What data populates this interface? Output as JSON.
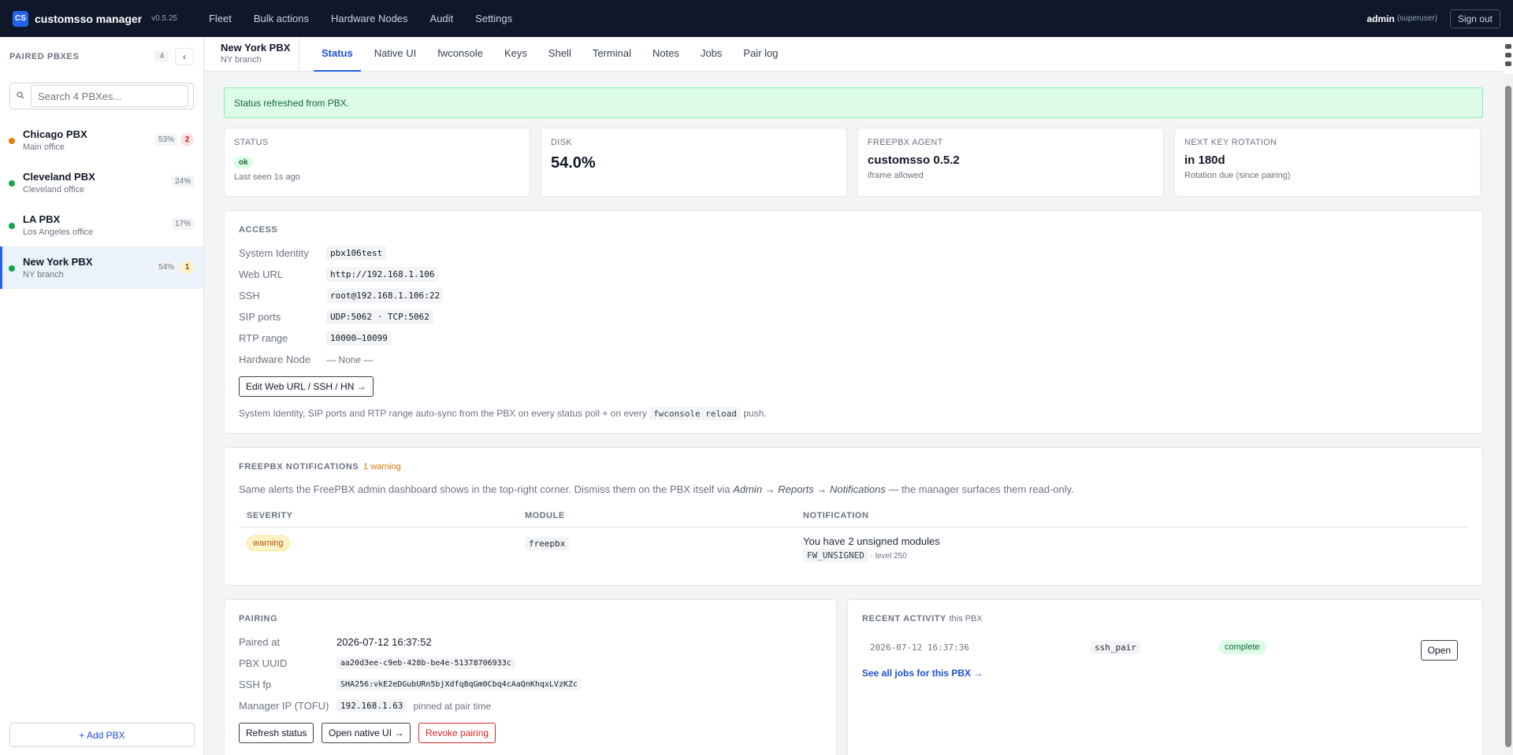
{
  "app": {
    "logo": "CS",
    "name": "customsso manager",
    "version": "v0.5.25"
  },
  "nav": [
    "Fleet",
    "Bulk actions",
    "Hardware Nodes",
    "Audit",
    "Settings"
  ],
  "user": {
    "name": "admin",
    "role": "(superuser)",
    "signout": "Sign out"
  },
  "sidebar": {
    "title": "PAIRED PBXES",
    "count": "4",
    "collapse_glyph": "‹",
    "search_placeholder": "Search 4 PBXes...",
    "items": [
      {
        "name": "Chicago PBX",
        "sub": "Main office",
        "pct": "53%",
        "alerts": "2",
        "alert_color": "red",
        "dot": "#ea7a0c"
      },
      {
        "name": "Cleveland PBX",
        "sub": "Cleveland office",
        "pct": "24%",
        "alerts": "",
        "dot": "#16a34a"
      },
      {
        "name": "LA PBX",
        "sub": "Los Angeles office",
        "pct": "17%",
        "alerts": "",
        "dot": "#16a34a"
      },
      {
        "name": "New York PBX",
        "sub": "NY branch",
        "pct": "54%",
        "alerts": "1",
        "alert_color": "yellow",
        "dot": "#16a34a"
      }
    ],
    "add_label": "+ Add PBX"
  },
  "header": {
    "pbx_name": "New York PBX",
    "pbx_sub": "NY branch",
    "tabs": [
      "Status",
      "Native UI",
      "fwconsole",
      "Keys",
      "Shell",
      "Terminal",
      "Notes",
      "Jobs",
      "Pair log"
    ],
    "active_tab": "Status"
  },
  "alert": "Status refreshed from PBX.",
  "cards": {
    "status": {
      "label": "STATUS",
      "badge": "ok",
      "sub": "Last seen 1s ago"
    },
    "disk": {
      "label": "DISK",
      "value": "54.0%"
    },
    "agent": {
      "label": "FREEPBX AGENT",
      "value": "customsso 0.5.2",
      "sub": "iframe allowed"
    },
    "rotation": {
      "label": "NEXT KEY ROTATION",
      "value": "in 180d",
      "sub": "Rotation due (since pairing)"
    }
  },
  "access": {
    "title": "ACCESS",
    "rows": [
      {
        "k": "System Identity",
        "v": "pbx106test"
      },
      {
        "k": "Web URL",
        "v": "http://192.168.1.106"
      },
      {
        "k": "SSH",
        "v": "root@192.168.1.106:22"
      },
      {
        "k": "SIP ports",
        "v": "UDP:5062 · TCP:5062"
      },
      {
        "k": "RTP range",
        "v": "10000–10099"
      }
    ],
    "hardware_node": {
      "k": "Hardware Node",
      "v": "— None —"
    },
    "edit_button": "Edit Web URL / SSH / HN →",
    "note_pre": "System Identity, SIP ports and RTP range auto-sync from the PBX on every status poll + on every",
    "note_code": "fwconsole reload",
    "note_post": "push."
  },
  "notifications": {
    "title": "FREEPBX NOTIFICATIONS",
    "count": "1 warning",
    "desc_pre": "Same alerts the FreePBX admin dashboard shows in the top-right corner. Dismiss them on the PBX itself via",
    "desc_path": "Admin → Reports → Notifications",
    "desc_post": "— the manager surfaces them read-only.",
    "columns": [
      "SEVERITY",
      "MODULE",
      "NOTIFICATION"
    ],
    "rows": [
      {
        "severity": "warning",
        "module": "freepbx",
        "text": "You have 2 unsigned modules",
        "code": "FW_UNSIGNED",
        "level": "· level 250"
      }
    ]
  },
  "pairing": {
    "title": "PAIRING",
    "paired_at": {
      "k": "Paired at",
      "v": "2026-07-12 16:37:52"
    },
    "uuid": {
      "k": "PBX UUID",
      "v": "aa20d3ee-c9eb-428b-be4e-51378706933c"
    },
    "ssh_fp": {
      "k": "SSH fp",
      "v": "SHA256:vkE2eDGubURn5bjXdfq8qGm0Cbq4cAaQnKhqxLVzKZc"
    },
    "manager_ip": {
      "k": "Manager IP (TOFU)",
      "v": "192.168.1.63",
      "note": "pinned at pair time"
    },
    "buttons": {
      "refresh": "Refresh status",
      "native": "Open native UI →",
      "revoke": "Revoke pairing"
    }
  },
  "activity": {
    "title": "RECENT ACTIVITY",
    "scope": "this PBX",
    "rows": [
      {
        "time": "2026-07-12 16:37:36",
        "type": "ssh_pair",
        "status": "complete",
        "action": "Open"
      }
    ],
    "see_all": "See all jobs for this PBX →"
  }
}
